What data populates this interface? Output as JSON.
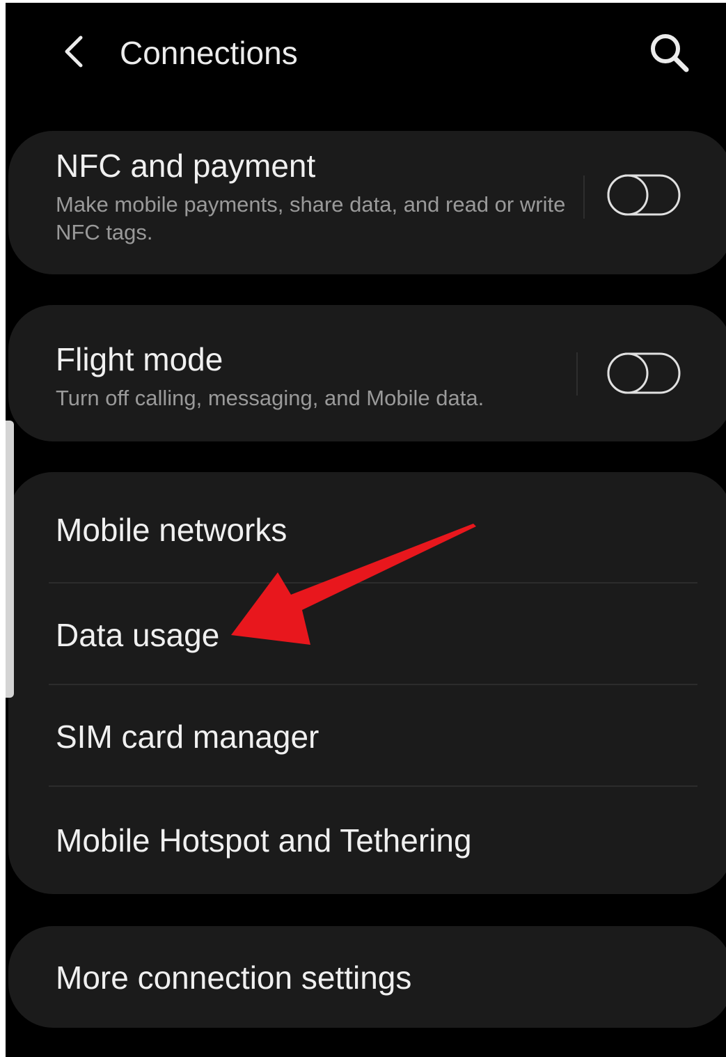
{
  "header": {
    "title": "Connections",
    "back_icon": "chevron-left-icon",
    "search_icon": "search-icon"
  },
  "nfc": {
    "title": "NFC and payment",
    "subtitle": "Make mobile payments, share data, and read or write NFC tags.",
    "enabled": false
  },
  "flight_mode": {
    "title": "Flight mode",
    "subtitle": "Turn off calling, messaging, and Mobile data.",
    "enabled": false
  },
  "menu": {
    "items": [
      {
        "label": "Mobile networks"
      },
      {
        "label": "Data usage"
      },
      {
        "label": "SIM card manager"
      },
      {
        "label": "Mobile Hotspot and Tethering"
      }
    ]
  },
  "more": {
    "label": "More connection settings"
  },
  "colors": {
    "background": "#000000",
    "card": "#1b1b1b",
    "annotation_arrow": "#e8171d"
  }
}
